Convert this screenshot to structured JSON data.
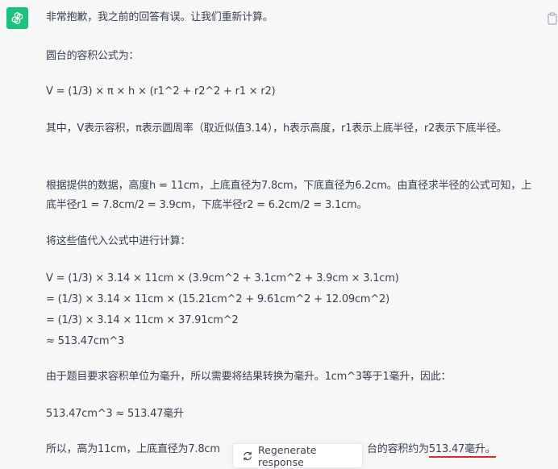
{
  "message": {
    "lines": {
      "l1": "非常抱歉，我之前的回答有误。让我们重新计算。",
      "l2": "圆台的容积公式为：",
      "l3": "V = (1/3) × π × h × (r1^2 + r2^2 + r1 × r2)",
      "l4": "其中，V表示容积，π表示圆周率（取近似值3.14），h表示高度，r1表示上底半径，r2表示下底半径。",
      "l5": "根据提供的数据，高度h = 11cm，上底直径为7.8cm，下底直径为6.2cm。由直径求半径的公式可知，上底半径r1 = 7.8cm/2 = 3.9cm，下底半径r2 = 6.2cm/2 = 3.1cm。",
      "l6": "将这些值代入公式中进行计算：",
      "calc1": "V = (1/3) × 3.14 × 11cm × (3.9cm^2 + 3.1cm^2 + 3.9cm × 3.1cm)",
      "calc2": "= (1/3) × 3.14 × 11cm × (15.21cm^2 + 9.61cm^2 + 12.09cm^2)",
      "calc3": "= (1/3) × 3.14 × 11cm × 37.91cm^2",
      "calc4": "≈ 513.47cm^3",
      "l7": "由于题目要求容积单位为毫升，所以需要将结果转换为毫升。1cm^3等于1毫升，因此：",
      "l8": "513.47cm^3 ≈ 513.47毫升",
      "l9_prefix": "所以，高为11cm，上底直径为7.8cm",
      "l9_mid": "台的容积约为",
      "l9_highlight": "513.47毫升",
      "l9_end": "。"
    }
  },
  "regenerate": {
    "label": "Regenerate response"
  },
  "icons": {
    "avatar": "openai-logo-icon",
    "copy": "clipboard-icon",
    "regenerate": "refresh-icon"
  },
  "colors": {
    "avatar_bg": "#19c37d",
    "underline": "#e5242b"
  }
}
